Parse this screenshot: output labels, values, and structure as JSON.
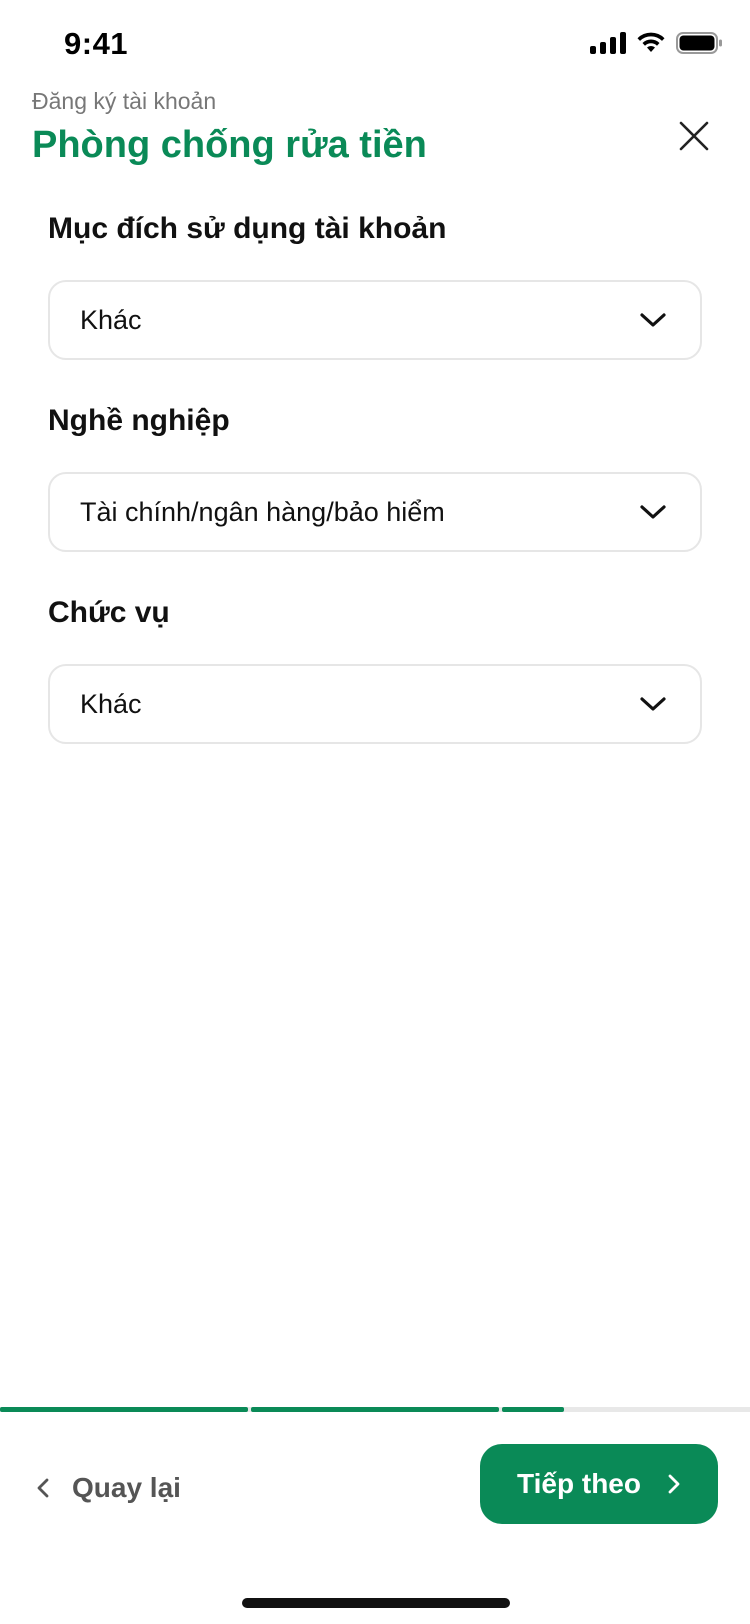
{
  "status_bar": {
    "time": "9:41",
    "icons": [
      "signal-icon",
      "wifi-icon",
      "battery-icon"
    ]
  },
  "header": {
    "breadcrumb": "Đăng ký tài khoản",
    "title": "Phòng chống rửa tiền",
    "close_icon": "close-icon"
  },
  "form": {
    "fields": [
      {
        "label": "Mục đích sử dụng tài khoản",
        "value": "Khác"
      },
      {
        "label": "Nghề nghiệp",
        "value": "Tài chính/ngân hàng/bảo hiểm"
      },
      {
        "label": "Chức vụ",
        "value": "Khác"
      }
    ]
  },
  "progress": {
    "completed_steps": 2,
    "current_step_fraction": 0.25,
    "total_steps": 3
  },
  "footer": {
    "back_label": "Quay lại",
    "next_label": "Tiếp theo"
  },
  "colors": {
    "accent": "#0a8a57",
    "track": "#e8e8e8",
    "border": "#e6e6e6"
  }
}
